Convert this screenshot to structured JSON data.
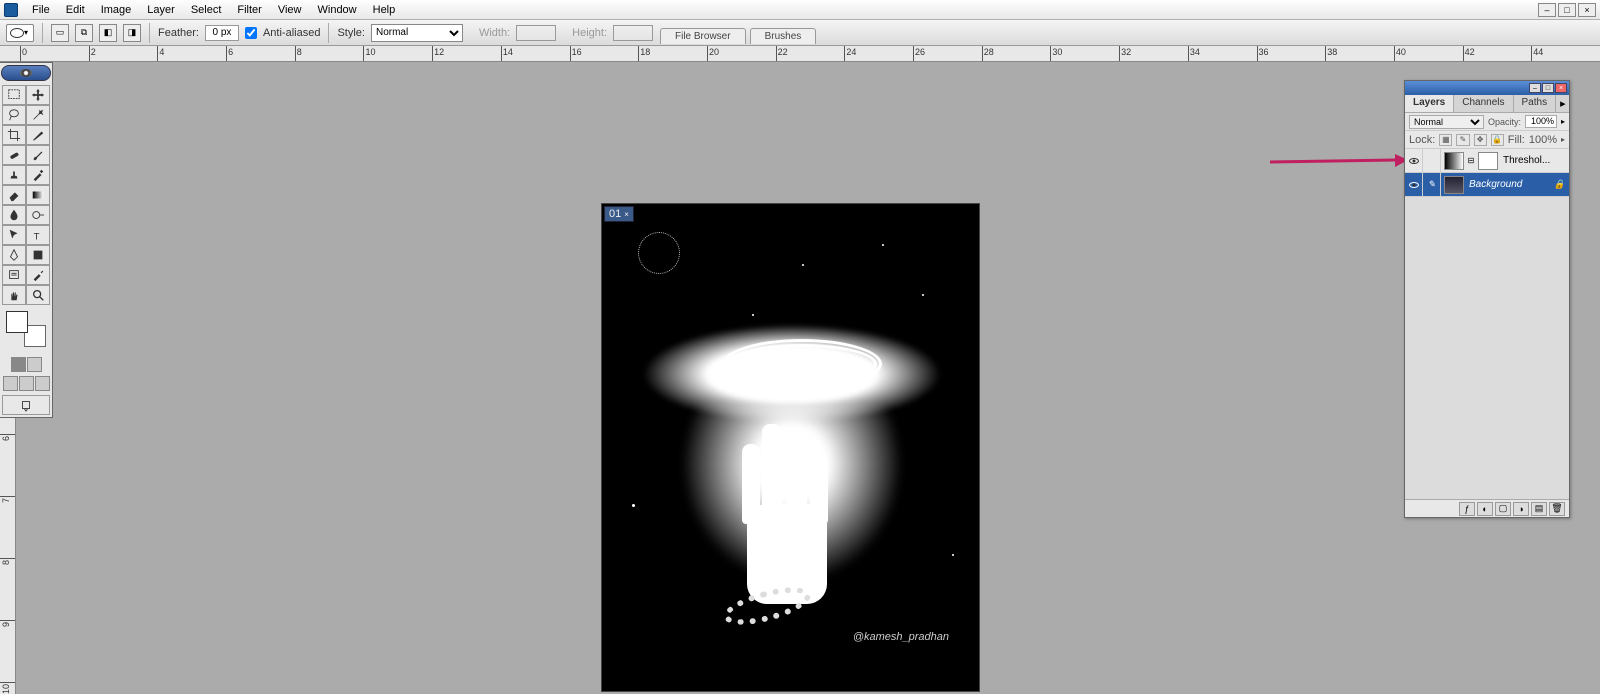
{
  "menu": {
    "items": [
      "File",
      "Edit",
      "Image",
      "Layer",
      "Select",
      "Filter",
      "View",
      "Window",
      "Help"
    ]
  },
  "options": {
    "feather_label": "Feather:",
    "feather_value": "0 px",
    "antialias_label": "Anti-aliased",
    "style_label": "Style:",
    "style_value": "Normal",
    "width_label": "Width:",
    "height_label": "Height:"
  },
  "palette_tabs": [
    "File Browser",
    "Brushes"
  ],
  "ruler_start": 0,
  "ruler_step": 2,
  "ruler_count": 23,
  "canvas": {
    "tab_label": "01",
    "credit": "@kamesh_pradhan"
  },
  "layers_panel": {
    "tabs": [
      "Layers",
      "Channels",
      "Paths"
    ],
    "blend_mode": "Normal",
    "opacity_label": "Opacity:",
    "opacity_value": "100%",
    "lock_label": "Lock:",
    "fill_label": "Fill:",
    "fill_value": "100%",
    "layers": [
      {
        "name": "Threshol...",
        "type": "adjustment",
        "selected": false,
        "locked": false
      },
      {
        "name": "Background",
        "type": "image",
        "selected": true,
        "locked": true
      }
    ]
  },
  "annotation_color": "#c02060"
}
